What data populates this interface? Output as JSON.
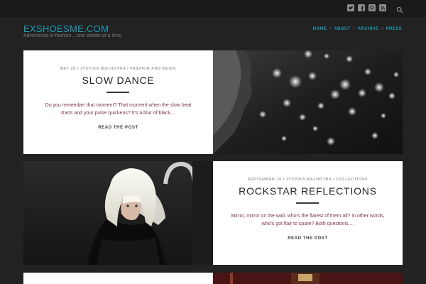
{
  "site": {
    "title": "EXSHOESME.COM",
    "tagline": "Adventures in fashion....one stiletto at a time."
  },
  "social_icons": [
    "twitter-icon",
    "facebook-icon",
    "pinterest-icon",
    "rss-icon"
  ],
  "nav": {
    "items": [
      "HOME",
      "ABOUT",
      "ARCHIVE",
      "PRESS"
    ],
    "separator": "/"
  },
  "posts": [
    {
      "meta": "MAY 29 / JYOTIKA MALHOTRA / FASHION AND MUSIC",
      "title": "SLOW DANCE",
      "excerpt": "Do you remember that moment? That moment when the slow beat starts and your pulse quickens? It's a blur of black....",
      "read_more": "READ THE POST",
      "image": "black-and-white-bokeh-portrait"
    },
    {
      "meta": "SEPTEMBER 16 / JYOTIKA MALHOTRA / COLLECTIONS",
      "title": "ROCKSTAR REFLECTIONS",
      "excerpt": "Mirror, mirror on the wall, who's the flarest of them all? In other words, who's got flair to spare? Both questions....",
      "read_more": "READ THE POST",
      "image": "platinum-blonde-runway-model"
    }
  ],
  "colors": {
    "background": "#222222",
    "topbar": "#1a1a1a",
    "accent": "#1e9cb1",
    "excerpt": "#7a3355",
    "card": "#ffffff"
  }
}
